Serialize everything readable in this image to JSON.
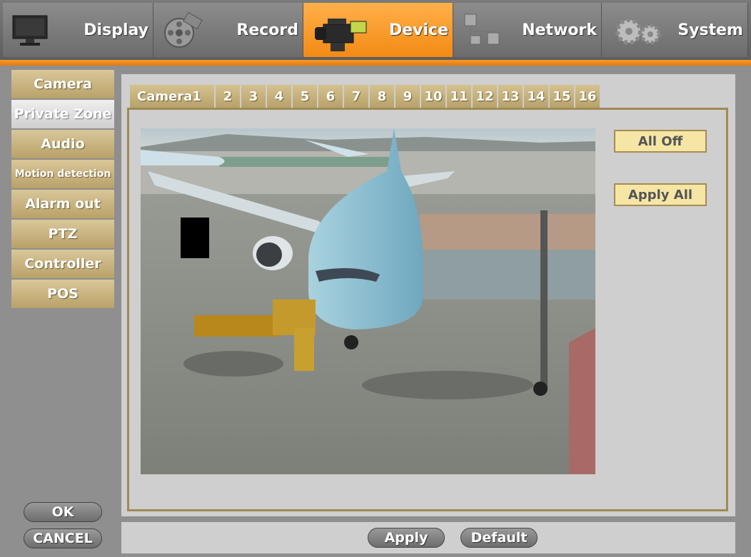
{
  "nav": {
    "tabs": [
      {
        "label": "Display",
        "icon": "monitor-icon"
      },
      {
        "label": "Record",
        "icon": "film-reel-icon"
      },
      {
        "label": "Device",
        "icon": "camcorder-icon"
      },
      {
        "label": "Network",
        "icon": "network-icon"
      },
      {
        "label": "System",
        "icon": "gears-icon"
      }
    ],
    "active": "Device",
    "accent_color": "#f39020"
  },
  "sidebar": {
    "items": [
      {
        "label": "Camera"
      },
      {
        "label": "Private Zone"
      },
      {
        "label": "Audio"
      },
      {
        "label": "Motion detection"
      },
      {
        "label": "Alarm out"
      },
      {
        "label": "PTZ"
      },
      {
        "label": "Controller"
      },
      {
        "label": "POS"
      }
    ],
    "active": "Private Zone"
  },
  "camera_tabs": {
    "items": [
      "Camera1",
      "2",
      "3",
      "4",
      "5",
      "6",
      "7",
      "8",
      "9",
      "10",
      "11",
      "12",
      "13",
      "14",
      "15",
      "16"
    ],
    "active": "Camera1"
  },
  "zone_controls": {
    "all_off_label": "All Off",
    "apply_all_label": "Apply All"
  },
  "footer": {
    "ok_label": "OK",
    "cancel_label": "CANCEL",
    "apply_label": "Apply",
    "default_label": "Default"
  }
}
